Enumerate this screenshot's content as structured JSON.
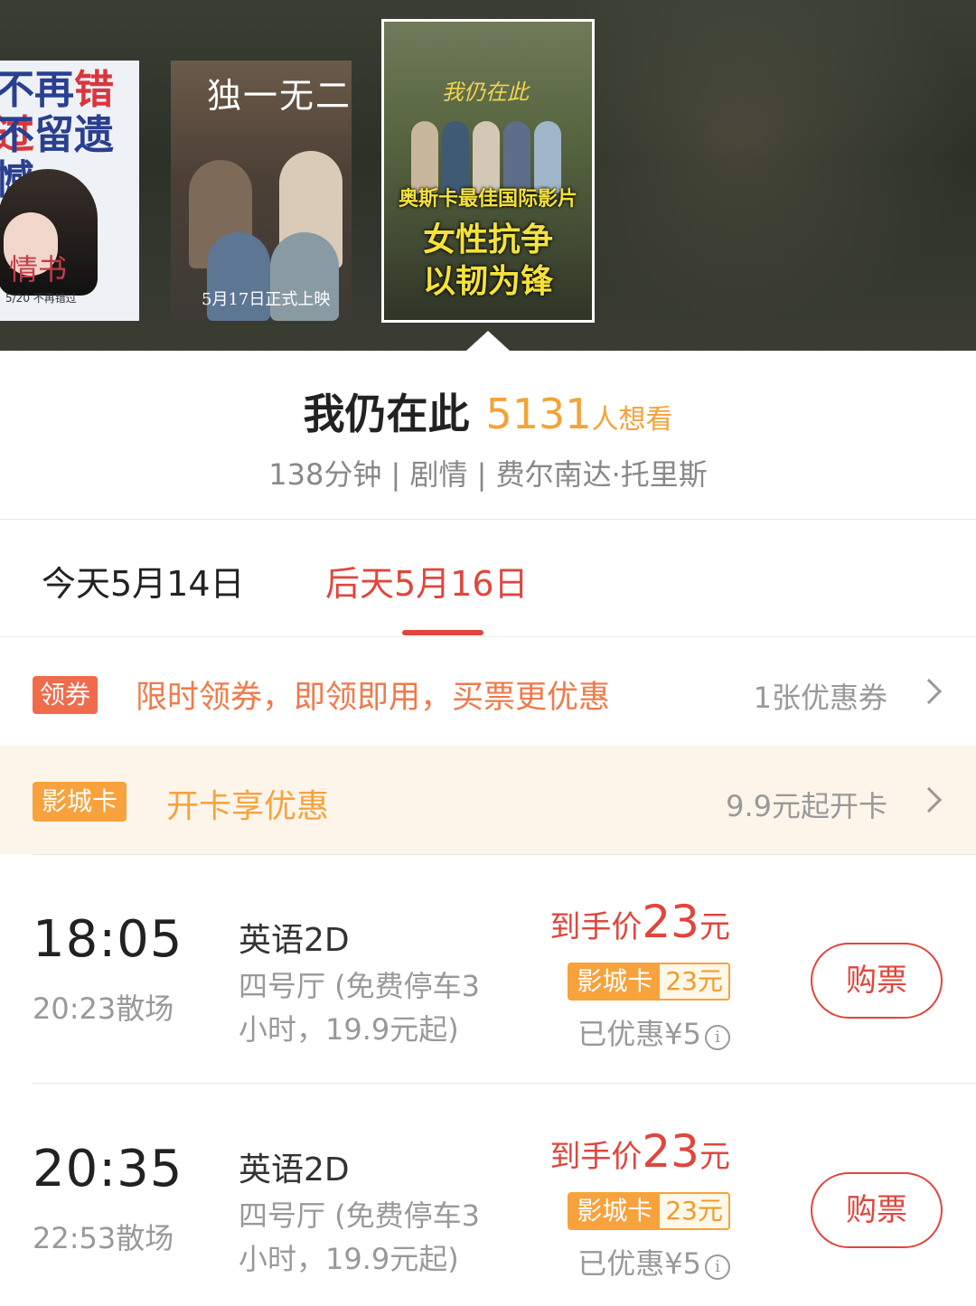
{
  "posters": [
    {
      "line1a": "不再",
      "line1b": "错过",
      "line2a": "不留",
      "line2b": "遗憾",
      "title": "情书",
      "date": "5/20 不再错过"
    },
    {
      "title": "独一无二",
      "date": "5月17日正式上映"
    },
    {
      "title": "我仍在此",
      "slogan1": "奥斯卡最佳国际影片",
      "slogan2": "女性抗争",
      "slogan3": "以韧为锋"
    }
  ],
  "movie": {
    "title": "我仍在此",
    "want_count": "5131",
    "want_suffix": "人想看",
    "meta": "138分钟 | 剧情 | 费尔南达·托里斯"
  },
  "tabs": {
    "today": "今天5月14日",
    "after": "后天5月16日",
    "selected": "after"
  },
  "coupon": {
    "badge": "领券",
    "text": "限时领券，即领即用，买票更优惠",
    "count": "1张优惠券"
  },
  "card": {
    "badge": "影城卡",
    "text": "开卡享优惠",
    "price": "9.9元起开卡"
  },
  "showtimes": [
    {
      "start": "18:05",
      "end": "20:23散场",
      "lang": "英语2D",
      "hall": "四号厅 (免费停车3小时，19.9元起)",
      "price_label": "到手价",
      "price": "23",
      "price_unit": "元",
      "card_label": "影城卡",
      "card_price": "23元",
      "discount": "已优惠¥5",
      "button": "购票"
    },
    {
      "start": "20:35",
      "end": "22:53散场",
      "lang": "英语2D",
      "hall": "四号厅 (免费停车3小时，19.9元起)",
      "price_label": "到手价",
      "price": "23",
      "price_unit": "元",
      "card_label": "影城卡",
      "card_price": "23元",
      "discount": "已优惠¥5",
      "button": "购票"
    }
  ],
  "icons": {
    "chevron": "chevron-right-icon",
    "info": "info-icon"
  },
  "colors": {
    "accent_red": "#e0463d",
    "accent_orange": "#f3a33a",
    "card_bg": "#fdf5ea"
  }
}
